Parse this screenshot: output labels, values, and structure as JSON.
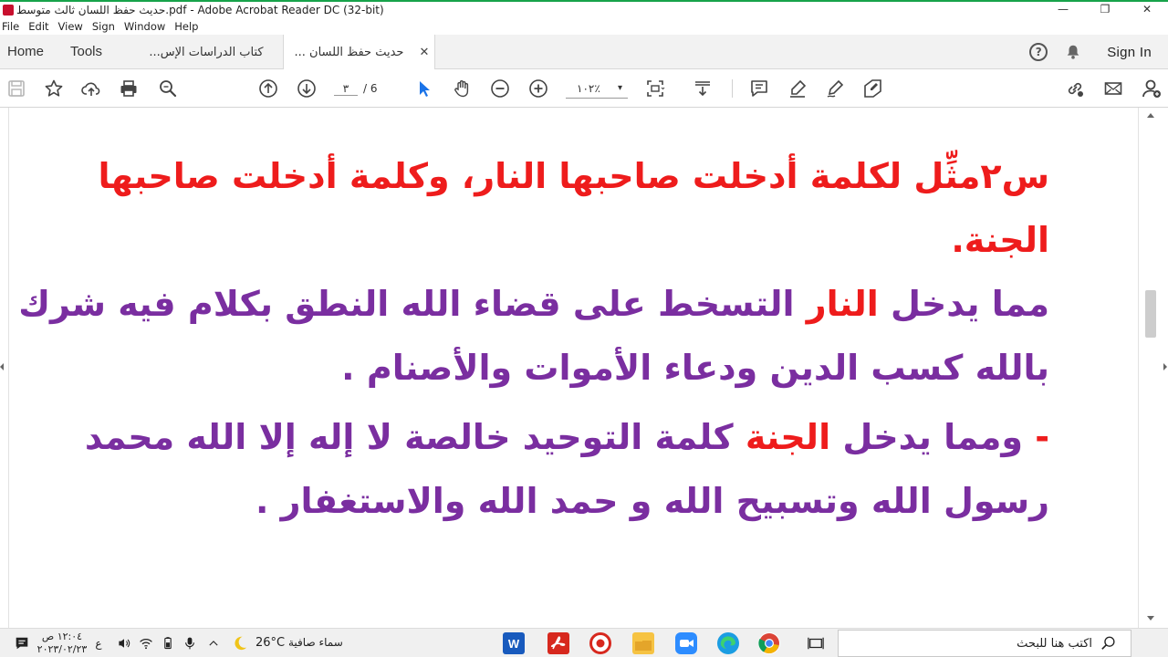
{
  "window": {
    "title": "حديث حفظ اللسان ثالث متوسط.pdf - Adobe Acrobat Reader DC (32-bit)",
    "minimize": "—",
    "restore": "❐",
    "close": "✕"
  },
  "menu": [
    "File",
    "Edit",
    "View",
    "Sign",
    "Window",
    "Help"
  ],
  "tabs": {
    "home": "Home",
    "tools": "Tools",
    "doc_inactive": "كتاب الدراسات الإس...",
    "doc_active": "حديث حفظ اللسان ...",
    "close_glyph": "✕",
    "sign_in": "Sign In",
    "help_glyph": "?"
  },
  "toolbar": {
    "page_current": "٣",
    "page_total": "/  6",
    "zoom": "١٠٢٪",
    "zoom_caret": "▾"
  },
  "document": {
    "q_line1": "س٢مثِّل لكلمة أدخلت صاحبها النار، وكلمة أدخلت صاحبها",
    "q_line2": "الجنة.",
    "a1_prefix": "مما يدخل النار",
    "a1_rest": " التسخط على قضاء الله النطق بكلام فيه شرك",
    "a1_line2": "بالله كسب الدين ودعاء الأموات والأصنام .",
    "a2_dash": "- ",
    "a2_prefix": "ومما يدخل الجنة",
    "a2_rest": " كلمة التوحيد خالصة لا إله إلا الله محمد",
    "a2_line2": "رسول الله وتسبيح الله و حمد الله والاستغفار ."
  },
  "taskbar": {
    "time": "١٢:٠٤ ص",
    "date": "٢٠٢٣/٠٢/٢٣",
    "lang_indicator": "ع",
    "temperature": "26°C",
    "weather": "سماء صافية",
    "search_placeholder": "اكتب هنا للبحث"
  },
  "colors": {
    "red_text": "#ee1c1c",
    "purple_text": "#7a2ea0",
    "title_accent": "#17a34a"
  }
}
